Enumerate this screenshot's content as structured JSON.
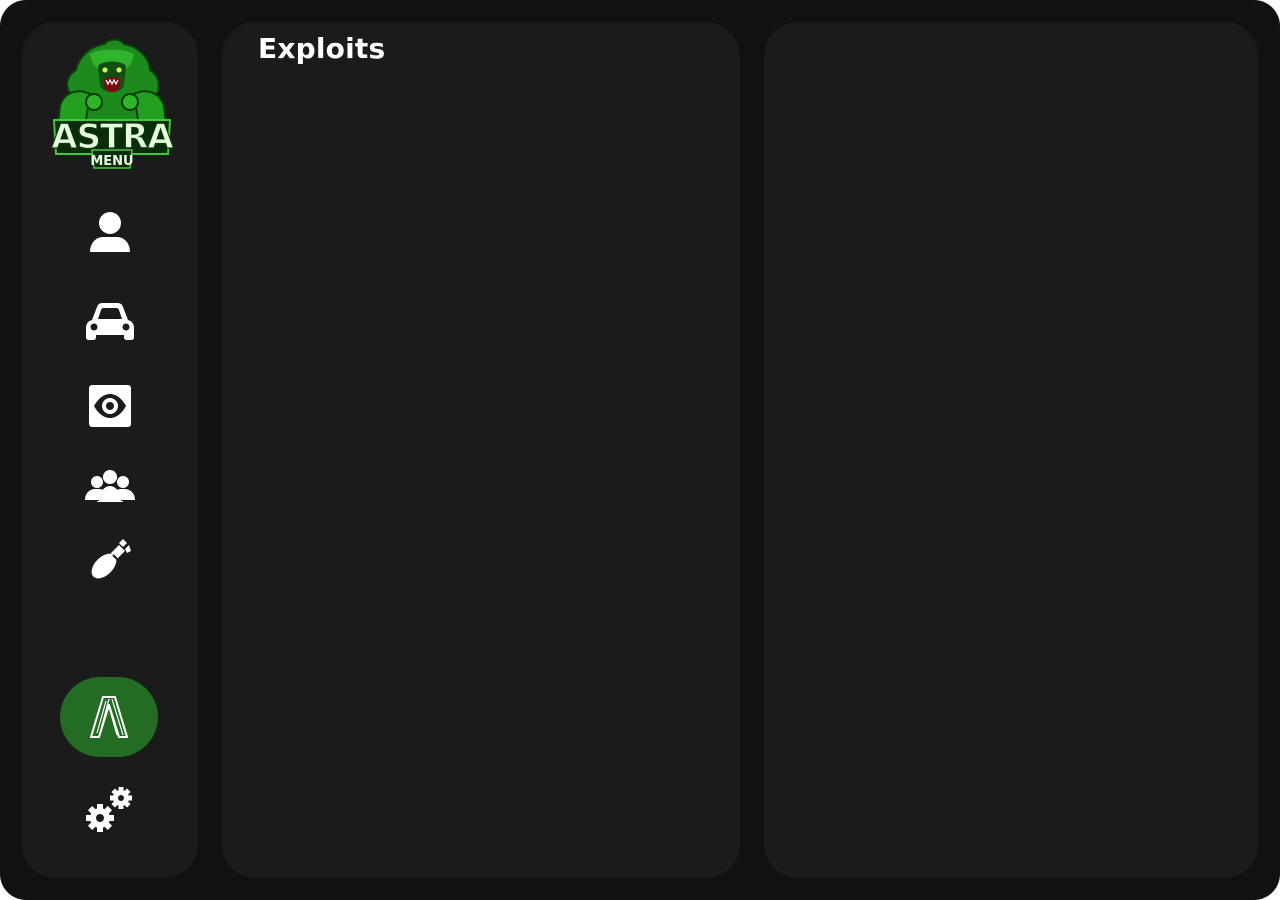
{
  "app": {
    "logo_text_main": "ASTRA",
    "logo_text_sub": "MENU"
  },
  "sidebar": {
    "items": [
      {
        "id": "player",
        "icon": "user-icon"
      },
      {
        "id": "vehicle",
        "icon": "car-icon"
      },
      {
        "id": "visual",
        "icon": "eye-icon"
      },
      {
        "id": "online-players",
        "icon": "group-icon"
      },
      {
        "id": "weapons",
        "icon": "bomb-icon"
      },
      {
        "id": "exploits",
        "icon": "exploit-logo-icon",
        "active": true
      },
      {
        "id": "settings",
        "icon": "gears-icon"
      }
    ]
  },
  "main": {
    "left_panel": {
      "title": "Exploits"
    },
    "right_panel": {}
  },
  "colors": {
    "window_bg": "#111111",
    "panel_bg": "#1b1b1b",
    "accent": "#246b23",
    "logo_green": "#3ec93a",
    "text": "#ffffff"
  }
}
